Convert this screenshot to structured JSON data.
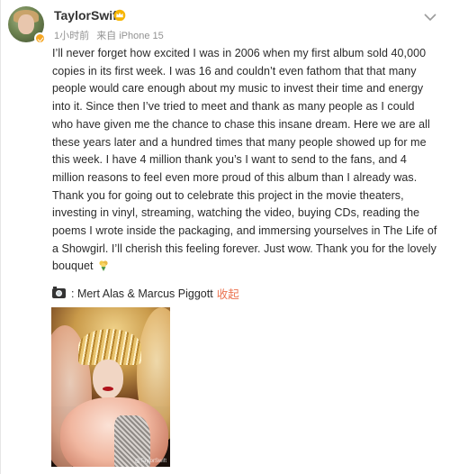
{
  "post": {
    "author": {
      "name": "TaylorSwift",
      "crown_badge": "gold-crown-icon",
      "verified_badge": "verified-orange-badge"
    },
    "meta": {
      "time": "1小时前",
      "source": "来自 iPhone 15"
    },
    "content": {
      "text": "I’ll never forget how excited I was in 2006 when my first album sold 40,000 copies in its first week. I was 16 and couldn’t even fathom that that many people would care enough about my music to invest their time and energy into it. Since then I’ve tried to meet and thank as many people as I could who have given me the chance to chase this insane dream. Here we are all these years later and a hundred times that many people showed up for me this week. I have 4 million thank you’s I want to send to the fans, and 4 million reasons to feel even more proud of this album than I already was. Thank you for going out to celebrate this project in the movie theaters, investing in vinyl, streaming, watching the video, buying CDs, reading the poems I wrote inside the packaging, and immersing yourselves in The Life of a Showgirl. I’ll cherish this feeling forever. Just wow. Thank you for the lovely bouquet",
      "trailing_emoji": "bouquet-icon"
    },
    "credit": {
      "icon": "camera-icon",
      "text": ": Mert Alas & Marcus Piggott",
      "collapse_label": "收起"
    },
    "image": {
      "watermark": "@TaylorSwift"
    },
    "colors": {
      "link_orange": "#eb7350",
      "meta_gray": "#939393",
      "verified_orange": "#f5a623"
    }
  }
}
